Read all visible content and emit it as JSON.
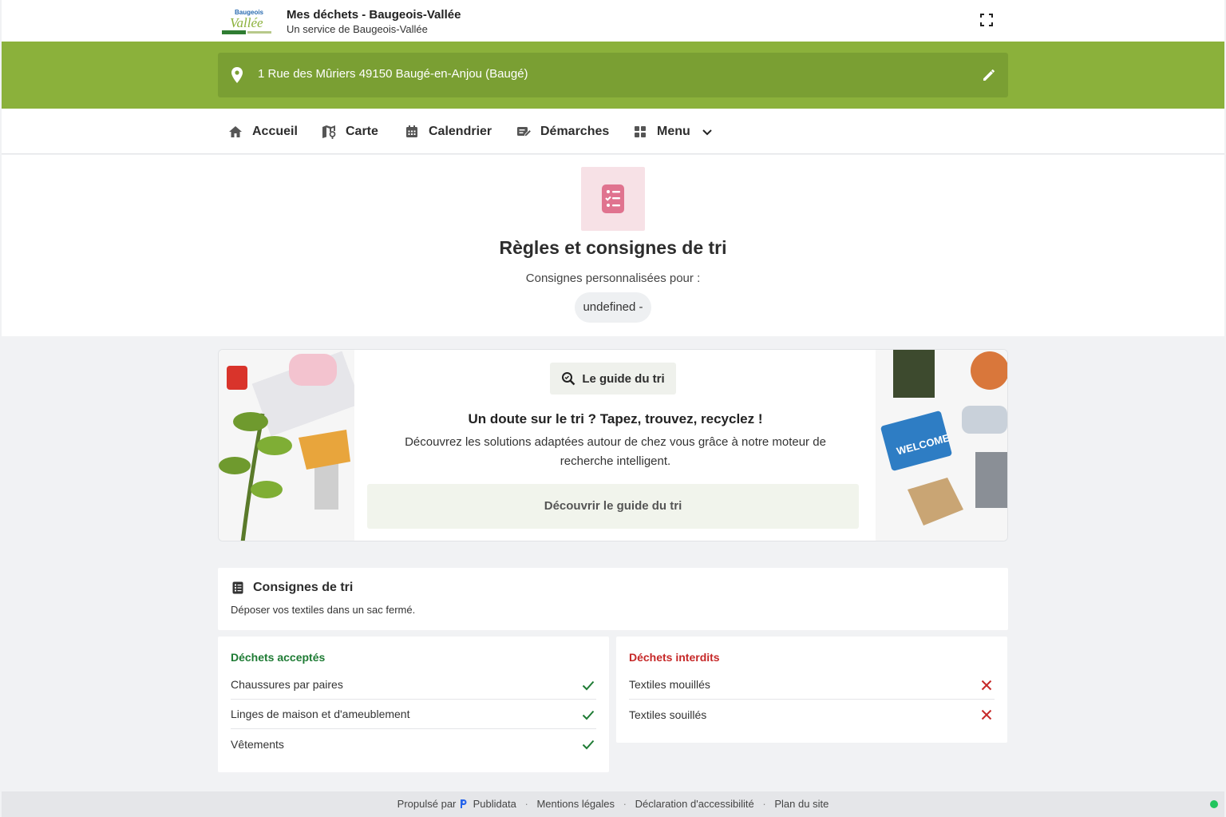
{
  "header": {
    "app_title": "Mes déchets - Baugeois-Vallée",
    "app_subtitle": "Un service de Baugeois-Vallée",
    "logo_text": "Baugeois Vallée"
  },
  "address": {
    "value": "1 Rue des Mûriers 49150 Baugé-en-Anjou (Baugé)"
  },
  "nav": {
    "accueil": "Accueil",
    "carte": "Carte",
    "calendrier": "Calendrier",
    "demarches": "Démarches",
    "menu": "Menu"
  },
  "hero": {
    "title": "Règles et consignes de tri",
    "subtitle": "Consignes personnalisées pour :",
    "pill": "undefined -"
  },
  "guide": {
    "chip": "Le guide du tri",
    "title": "Un doute sur le tri ? Tapez, trouvez, recyclez !",
    "text": "Découvrez les solutions adaptées autour de chez vous grâce à notre moteur de recherche intelligent.",
    "button": "Découvrir le guide du tri"
  },
  "consignes": {
    "title": "Consignes de tri",
    "description": "Déposer vos textiles dans un sac fermé."
  },
  "accepted": {
    "title": "Déchets acceptés",
    "items": [
      "Chaussures par paires",
      "Linges de maison et d'ameublement",
      "Vêtements"
    ]
  },
  "forbidden": {
    "title": "Déchets interdits",
    "items": [
      "Textiles mouillés",
      "Textiles souillés"
    ]
  },
  "footer": {
    "powered": "Propulsé par",
    "brand": "Publidata",
    "mentions": "Mentions légales",
    "accessibility": "Déclaration d'accessibilité",
    "sitemap": "Plan du site"
  },
  "colors": {
    "brand_green": "#8bb13b",
    "accepted": "#1e7b34",
    "forbidden": "#c62828"
  }
}
